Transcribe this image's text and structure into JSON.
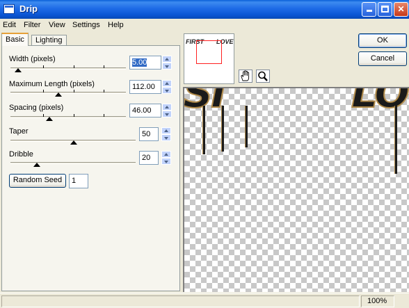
{
  "window": {
    "title": "Drip"
  },
  "menu": [
    "Edit",
    "Filter",
    "View",
    "Settings",
    "Help"
  ],
  "tabs": {
    "basic": "Basic",
    "lighting": "Lighting"
  },
  "fields": {
    "width": {
      "label": "Width (pixels)",
      "value": "5.00",
      "slider_fraction": 0.07
    },
    "max_length": {
      "label": "Maximum Length (pixels)",
      "value": "112.00",
      "slider_fraction": 0.38
    },
    "spacing": {
      "label": "Spacing (pixels)",
      "value": "46.00",
      "slider_fraction": 0.31
    },
    "taper": {
      "label": "Taper",
      "value": "50",
      "slider_fraction": 0.5
    },
    "dribble": {
      "label": "Dribble",
      "value": "20",
      "slider_fraction": 0.2
    }
  },
  "random_seed": {
    "label": "Random Seed",
    "value": "1"
  },
  "buttons": {
    "ok": "OK",
    "cancel": "Cancel"
  },
  "thumbnail": {
    "left_text": "FIRST",
    "right_text": "LOVE"
  },
  "preview": {
    "left_text": "SI",
    "right_text": "LO"
  },
  "status": {
    "zoom": "100%"
  },
  "colors": {
    "titlebar": "#0a55d4",
    "selection": "#316ac5",
    "thumb_frame": "#ff2020"
  }
}
